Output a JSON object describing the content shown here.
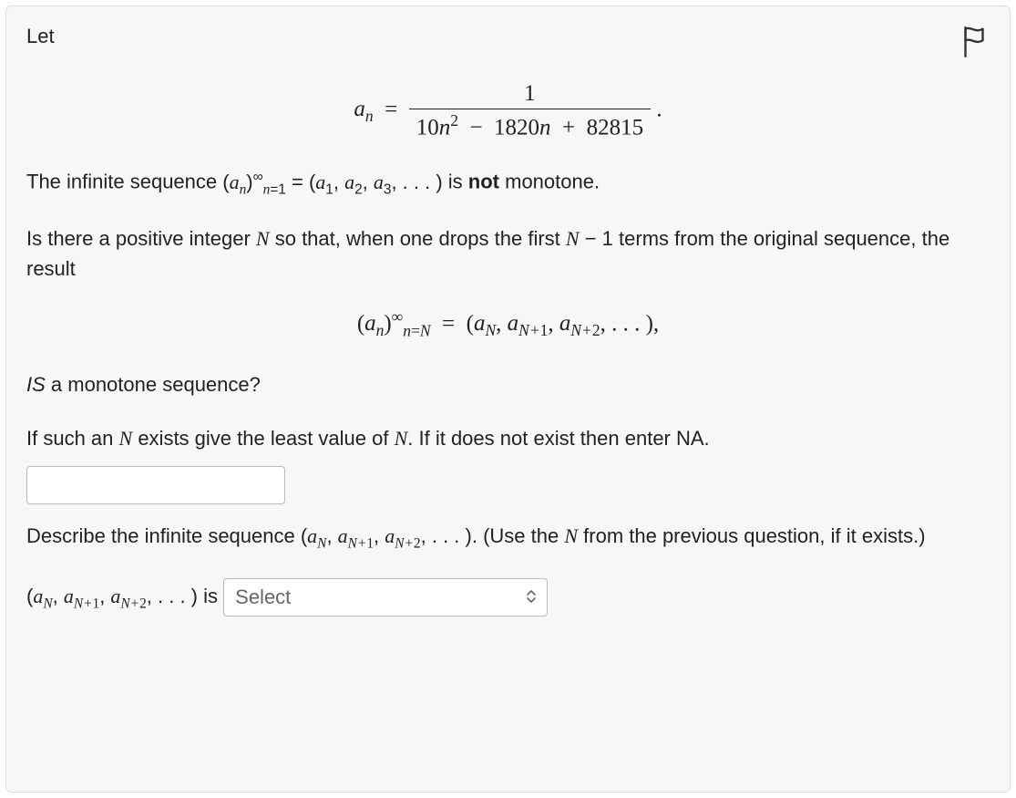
{
  "intro": "Let",
  "formula": {
    "lhs_var": "a",
    "lhs_sub": "n",
    "eq": "=",
    "num": "1",
    "den_html": "10<span class='math-inline'>n</span><sup>2</sup> &nbsp;&minus;&nbsp; 1820<span class='math-inline'>n</span> &nbsp;+&nbsp; 82815",
    "dot": "."
  },
  "line1": {
    "prefix": "The infinite sequence ",
    "seq_html": "(<span class='math-inline'>a<sub>n</sub></span>)<span class='sups'>&infin;</span><span class='subs'><span class='math-inline'>n</span>=1</span> = (<span class='math-inline'>a</span><sub>1</sub>, <span class='math-inline'>a</span><sub>2</sub>, <span class='math-inline'>a</span><sub>3</sub>, . . . )",
    "mid": " is ",
    "bold": "not",
    "suffix": " monotone."
  },
  "line2": {
    "text_html": "Is there a positive integer <span class='math-inline'>N</span> so that, when one drops the first <span class='math-inline'>N</span> &minus; 1 terms from the original sequence, the result"
  },
  "formula2": {
    "html": "(<span class='math-inline'>a<sub>n</sub></span>)<span class='sups'>&infin;</span><span class='subs'><span class='math-inline'>n</span>=<span class='math-inline'>N</span></span> &nbsp;=&nbsp; (<span class='math-inline'>a<sub>N</sub></span>, <span class='math-inline'>a<sub>N+<span class='rm'>1</span></sub></span>, <span class='math-inline'>a<sub>N+<span class='rm'>2</span></sub></span>, . . . ),"
  },
  "line3": {
    "prefix_italic": "IS",
    "suffix": " a monotone sequence?"
  },
  "line4": {
    "html": "If such an <span class='math-inline'>N</span> exists give the least value of <span class='math-inline'>N</span>. If it does not exist then enter NA."
  },
  "input_value": "",
  "line5": {
    "html": "Describe the infinite sequence (<span class='math-inline'>a<sub>N</sub></span>, <span class='math-inline'>a<sub>N+<span class='rm'>1</span></sub></span>, <span class='math-inline'>a<sub>N+<span class='rm'>2</span></sub></span>, . . . ). (Use the <span class='math-inline'>N</span> from the previous question, if it exists.)"
  },
  "line6": {
    "seq_html": "(<span class='math-inline'>a<sub>N</sub></span>, <span class='math-inline'>a<sub>N+<span class='rm'>1</span></sub></span>, <span class='math-inline'>a<sub>N+<span class='rm'>2</span></sub></span>, . . . )",
    "is_text": " is "
  },
  "select_placeholder": "Select"
}
